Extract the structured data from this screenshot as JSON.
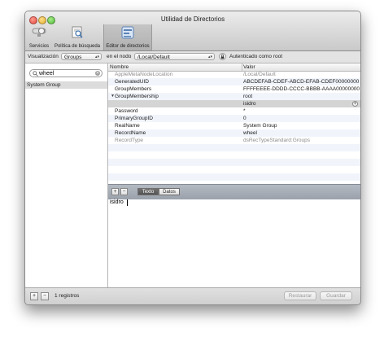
{
  "window": {
    "title": "Utilidad de Directorios"
  },
  "toolbar": {
    "items": [
      {
        "label": "Servicios",
        "icon": "services-switch-icon"
      },
      {
        "label": "Política de búsqueda",
        "icon": "search-policy-icon"
      },
      {
        "label": "Editor de directorios",
        "icon": "directory-editor-icon",
        "selected": true
      }
    ]
  },
  "controls": {
    "view_label": "Visualización",
    "view_value": "Groups",
    "node_label": "en el nodo",
    "node_value": "/Local/Default",
    "auth_text": "Autenticado como root"
  },
  "sidebar": {
    "search_value": "wheel",
    "groups": [
      "System Group"
    ]
  },
  "table": {
    "columns": [
      "Nombre",
      "Valor"
    ],
    "rows": [
      {
        "name": "AppleMetaNodeLocation",
        "value": "/Local/Default",
        "dim": true
      },
      {
        "name": "GeneratedUID",
        "value": "ABCDEFAB-CDEF-ABCD-EFAB-CDEF00000000"
      },
      {
        "name": "GroupMembers",
        "value": "FFFFEEEE-DDDD-CCCC-BBBB-AAAA00000000"
      },
      {
        "name": "GroupMembership",
        "value": "root",
        "expanded": true
      },
      {
        "name": "",
        "value": "isidro",
        "selected": true
      },
      {
        "name": "Password",
        "value": "*"
      },
      {
        "name": "PrimaryGroupID",
        "value": "0"
      },
      {
        "name": "RealName",
        "value": "System Group"
      },
      {
        "name": "RecordName",
        "value": "wheel"
      },
      {
        "name": "RecordType",
        "value": "dsRecTypeStandard:Groups",
        "dim": true
      }
    ]
  },
  "editor": {
    "segments": [
      "Texto",
      "Datos"
    ],
    "active_segment": "Texto",
    "text": "isidro"
  },
  "footer": {
    "count": "1 registros",
    "restore": "Restaurar",
    "save": "Guardar"
  },
  "colors": {
    "selection": "#d4d4d4",
    "alt_row": "#f1f5fb",
    "editbar": "#a7adb6"
  }
}
